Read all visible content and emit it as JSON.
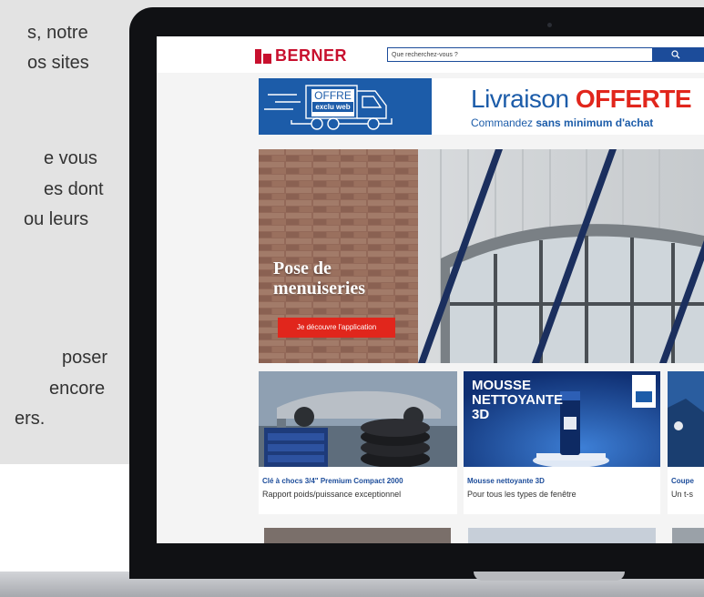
{
  "background_text": {
    "lines": [
      "s, notre",
      "os sites",
      "e vous",
      "es dont",
      "ou leurs",
      "poser",
      "encore",
      "ers."
    ]
  },
  "site": {
    "logo": "BERNER",
    "search": {
      "placeholder": "Que recherchez-vous ?"
    },
    "banner": {
      "badge_main": "OFFRE",
      "badge_sub": "exclu web",
      "title_prefix": "Livraison ",
      "title_highlight": "OFFERTE",
      "subtitle_prefix": "Commandez ",
      "subtitle_bold": "sans minimum d'achat"
    },
    "hero": {
      "title": "Pose de\nmenuiseries",
      "button": "Je découvre l'application"
    },
    "cards": [
      {
        "title": "Clé à chocs 3/4\" Premium Compact 2000",
        "description": "Rapport poids/puissance exceptionnel"
      },
      {
        "title": "Mousse nettoyante 3D",
        "description": "Pour tous les types de fenêtre",
        "image_text": "MOUSSE\nNETTOYANTE\n3D"
      },
      {
        "title": "Coupe",
        "description": "Un t-s"
      }
    ]
  },
  "colors": {
    "brand_red": "#c8102e",
    "brand_blue": "#1c5ca9",
    "cta_red": "#e1261c"
  }
}
